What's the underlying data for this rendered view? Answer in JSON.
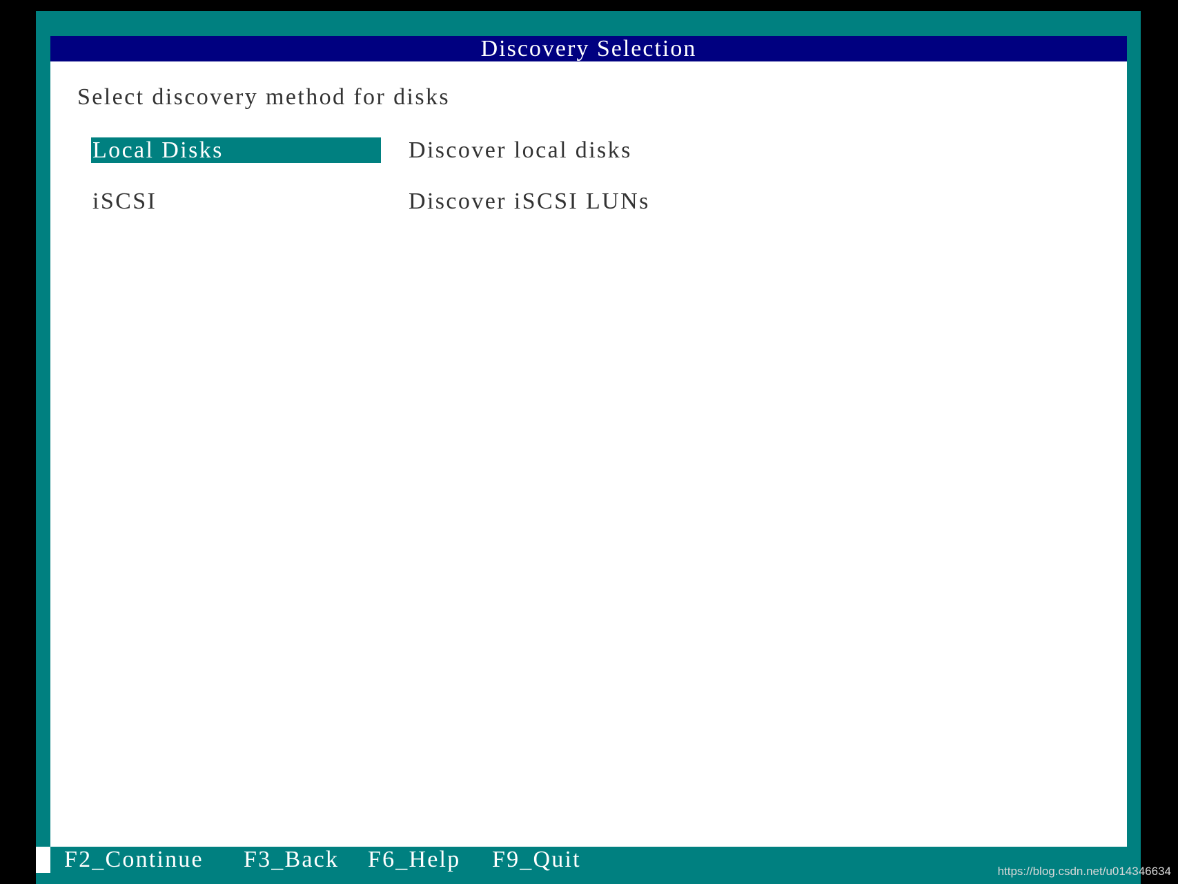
{
  "window": {
    "title": "Discovery Selection"
  },
  "prompt": "Select discovery method for disks",
  "options": [
    {
      "label": "Local Disks",
      "description": "Discover local disks",
      "selected": true
    },
    {
      "label": "iSCSI",
      "description": "Discover iSCSI LUNs",
      "selected": false
    }
  ],
  "footer": {
    "keys": [
      {
        "label": "F2_Continue"
      },
      {
        "label": "F3_Back"
      },
      {
        "label": "F6_Help"
      },
      {
        "label": "F9_Quit"
      }
    ]
  },
  "watermark": "https://blog.csdn.net/u014346634",
  "colors": {
    "frame": "#008080",
    "title_bar": "#000080",
    "selection": "#008080",
    "background": "#ffffff"
  }
}
